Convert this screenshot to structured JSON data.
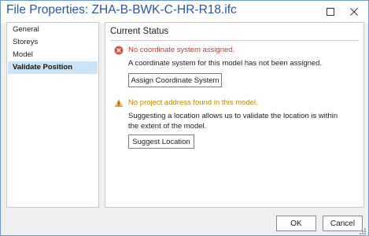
{
  "window": {
    "title": "File Properties: ZHA-B-BWK-C-HR-R18.ifc",
    "controls": {
      "maximize_icon": "maximize-icon",
      "close_icon": "close-icon"
    }
  },
  "sidebar": {
    "items": [
      {
        "label": "General",
        "active": false
      },
      {
        "label": "Storeys",
        "active": false
      },
      {
        "label": "Model",
        "active": false
      },
      {
        "label": "Validate Position",
        "active": true
      }
    ],
    "active_color": "#cce4f7"
  },
  "main": {
    "section_title": "Current Status",
    "issues": [
      {
        "icon": "error-circle-icon",
        "title": "No coordinate system assigned.",
        "title_color": "#c0392b",
        "description": "A coordinate system for this model has not been assigned.",
        "button_label": "Assign Coordinate System"
      },
      {
        "icon": "warning-triangle-icon",
        "title": "No project address found in this model.",
        "title_color": "#b58a00",
        "description": "Suggesting a location allows us to validate the location is within the extent of the model.",
        "button_label": "Suggest Location"
      }
    ]
  },
  "footer": {
    "ok_label": "OK",
    "cancel_label": "Cancel"
  },
  "colors": {
    "title_text": "#2b579a",
    "window_border": "#6d9bd1",
    "error": "#d9534f",
    "warning": "#f0ad4e"
  }
}
